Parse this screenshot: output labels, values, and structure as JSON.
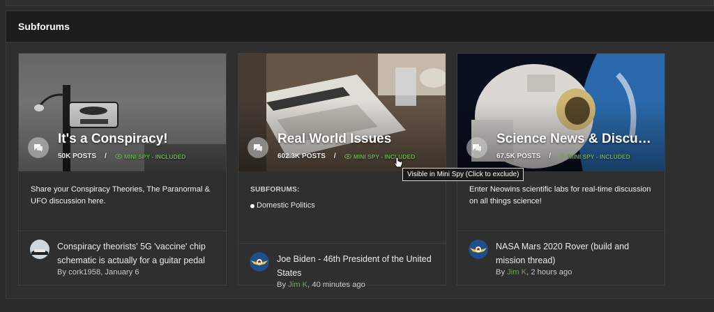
{
  "section": {
    "title": "Subforums"
  },
  "cards": [
    {
      "title": "It's a Conspiracy!",
      "posts": "50K POSTS",
      "spy": "MINI SPY - INCLUDED",
      "description": "Share your Conspiracy Theories, The Paranormal & UFO discussion here.",
      "latest": {
        "title": "Conspiracy theorists' 5G 'vaccine' chip schematic is actually for a guitar pedal",
        "by": "By",
        "author": "cork1958",
        "date": ", January 6"
      }
    },
    {
      "title": "Real World Issues",
      "posts": "602.3K POSTS",
      "spy": "MINI SPY - INCLUDED",
      "subforums_label": "SUBFORUMS:",
      "subforum_item": "Domestic Politics",
      "latest": {
        "title": "Joe Biden - 46th President of the United States",
        "by": "By",
        "author": "Jim K",
        "date": ", 40 minutes ago"
      }
    },
    {
      "title": "Science News & Discuss...",
      "posts": "67.5K POSTS",
      "spy": "MINI SPY - INCLUDED",
      "description": "Enter Neowins scientific labs for real-time discussion on all things science!",
      "latest": {
        "title": "NASA Mars 2020 Rover (build and mission thread)",
        "by": "By",
        "author": "Jim K",
        "date": ", 2 hours ago"
      }
    }
  ],
  "tooltip": "Visible in Mini Spy (Click to exclude)",
  "colors": {
    "panel_bg": "#2f2f2f",
    "header_bg": "#1c1c1c",
    "accent_green": "#6aa84f"
  },
  "icons": [
    "comment-icon",
    "eye-icon",
    "cursor-hand-icon"
  ]
}
